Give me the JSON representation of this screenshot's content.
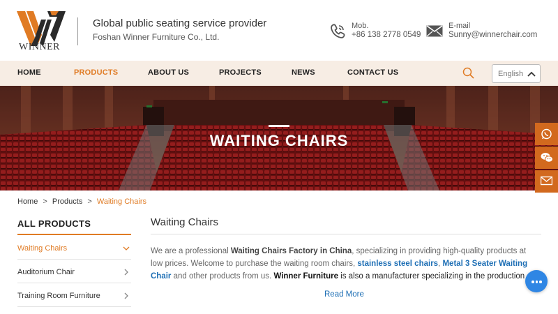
{
  "header": {
    "logo_text": "WINNER",
    "tagline": "Global public seating service provider",
    "company": "Foshan Winner Furniture Co., Ltd.",
    "mob_label": "Mob.",
    "mob_value": "+86 138 2778 0549",
    "email_label": "E-mail",
    "email_value": "Sunny@winnerchair.com"
  },
  "nav": {
    "items": [
      {
        "label": "HOME",
        "active": false
      },
      {
        "label": "PRODUCTS",
        "active": true
      },
      {
        "label": "ABOUT US",
        "active": false
      },
      {
        "label": "PROJECTS",
        "active": false
      },
      {
        "label": "NEWS",
        "active": false
      },
      {
        "label": "CONTACT US",
        "active": false
      }
    ],
    "language": "English"
  },
  "banner": {
    "title": "WAITING CHAIRS"
  },
  "breadcrumb": {
    "items": [
      "Home",
      "Products",
      "Waiting Chairs"
    ],
    "separator": ">"
  },
  "sidebar": {
    "title": "ALL PRODUCTS",
    "items": [
      {
        "label": "Waiting Chairs",
        "active": true
      },
      {
        "label": "Auditorium Chair",
        "active": false
      },
      {
        "label": "Training Room Furniture",
        "active": false
      }
    ]
  },
  "main": {
    "title": "Waiting Chairs",
    "desc": {
      "p1": "We are a professional ",
      "b1": "Waiting Chairs Factory in China",
      "p2": ", specializing in providing high-quality products at low prices. Welcome to purchase the waiting room chairs, ",
      "l1": "stainless steel chairs",
      "p3": ", ",
      "l2": "Metal 3 Seater Waiting Chair",
      "p4": " and other products from us. ",
      "b2": "Winner Furniture",
      "p5": " is also a manufacturer specializing in the production of public"
    },
    "read_more": "Read More"
  },
  "colors": {
    "accent": "#e07b24",
    "link": "#1e6fb5",
    "nav_bg": "#f7ede4",
    "float_bg": "#d2691e",
    "chat_bg": "#2f86e4"
  },
  "icons": {
    "mob": "phone-icon",
    "email": "mail-icon",
    "search": "search-icon",
    "float": [
      "whatsapp-icon",
      "wechat-icon",
      "mail-icon"
    ],
    "chat": "chat-icon"
  }
}
